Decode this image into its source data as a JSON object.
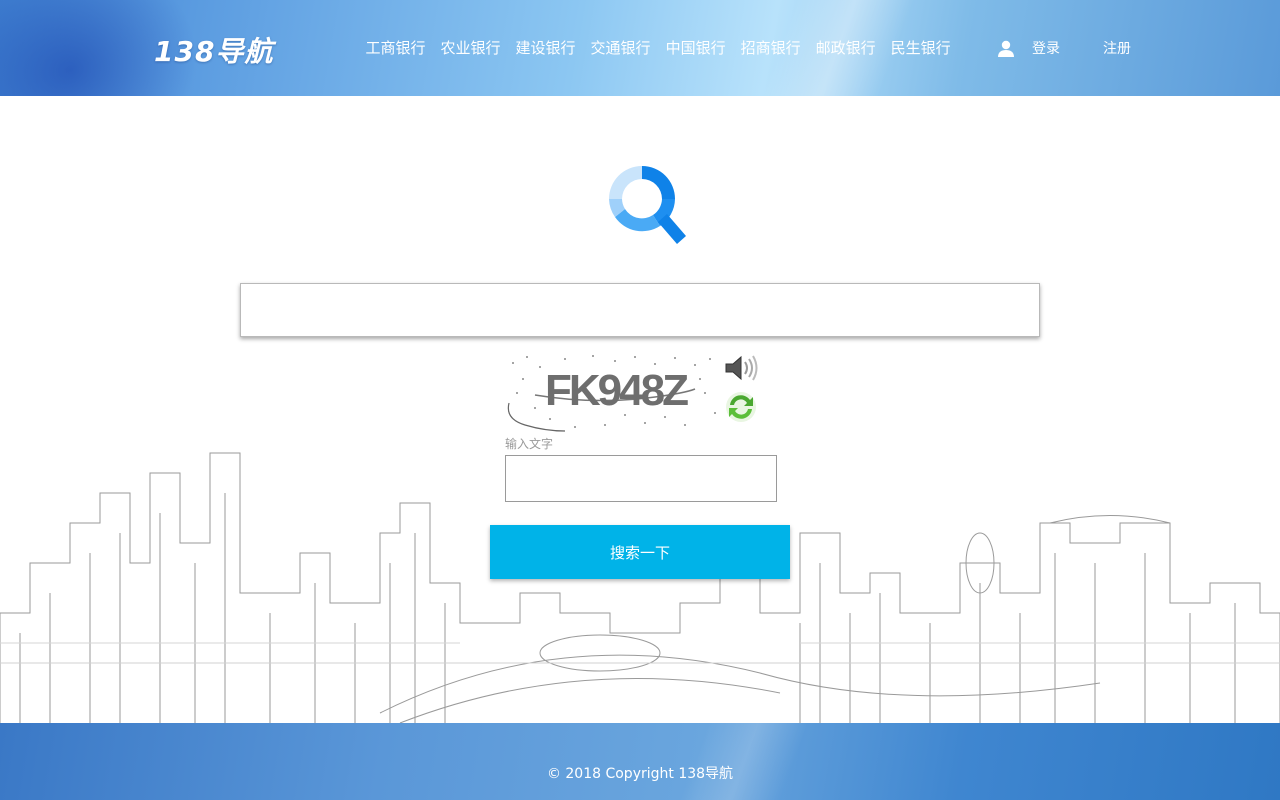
{
  "header": {
    "logo_text": "138导航",
    "nav": [
      "工商银行",
      "农业银行",
      "建设银行",
      "交通银行",
      "中国银行",
      "招商银行",
      "邮政银行",
      "民生银行"
    ],
    "login_label": "登录",
    "register_label": "注册"
  },
  "search": {
    "input_value": "",
    "captcha_text": "FK948Z",
    "captcha_label": "输入文字",
    "captcha_input_value": "",
    "button_label": "搜索一下"
  },
  "footer": {
    "copyright": "© 2018 Copyright 138导航"
  },
  "colors": {
    "accent_button": "#00b3e8",
    "logo_blue": "#0f82e8",
    "header_blue": "#5a9be0"
  }
}
